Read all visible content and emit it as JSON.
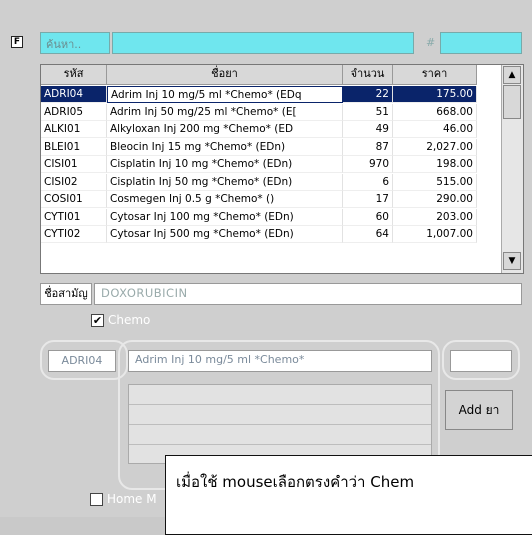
{
  "search": {
    "placeholder": "ค้นหา..",
    "hash_label": "#"
  },
  "grid": {
    "columns": [
      "รหัส",
      "ชื่อยา",
      "จำนวน",
      "ราคา"
    ],
    "rows": [
      [
        "ADRI04",
        "Adrim Inj 10 mg/5 ml  *Chemo* (EDq",
        "22",
        "175.00"
      ],
      [
        "ADRI05",
        "Adrim Inj 50 mg/25 ml  *Chemo* (E[",
        "51",
        "668.00"
      ],
      [
        "ALKI01",
        "Alkyloxan Inj 200 mg  *Chemo* (ED",
        "49",
        "46.00"
      ],
      [
        "BLEI01",
        "Bleocin Inj 15 mg  *Chemo* (EDn)",
        "87",
        "2,027.00"
      ],
      [
        "CISI01",
        "Cisplatin Inj 10 mg  *Chemo* (EDn)",
        "970",
        "198.00"
      ],
      [
        "CISI02",
        "Cisplatin Inj 50 mg  *Chemo* (EDn)",
        "6",
        "515.00"
      ],
      [
        "COSI01",
        "Cosmegen Inj 0.5 g *Chemo* ()",
        "17",
        "290.00"
      ],
      [
        "CYTI01",
        "Cytosar Inj 100 mg  *Chemo* (EDn)",
        "60",
        "203.00"
      ],
      [
        "CYTI02",
        "Cytosar Inj 500 mg  *Chemo* (EDn)",
        "64",
        "1,007.00"
      ]
    ],
    "selected_index": 0
  },
  "generic": {
    "label": "ชื่อสามัญ",
    "value": "DOXORUBICIN"
  },
  "chemo": {
    "label": "Chemo",
    "checked": true
  },
  "selected": {
    "code": "ADRI04",
    "name": "Adrim Inj 10 mg/5 ml  *Chemo*"
  },
  "add_button": {
    "label": "Add ยา"
  },
  "home_med": {
    "label": "Home M"
  },
  "tooltip": {
    "line1": "เมื่อใช้ mouseเลือกตรงคำว่า Chem",
    "line2": ""
  }
}
